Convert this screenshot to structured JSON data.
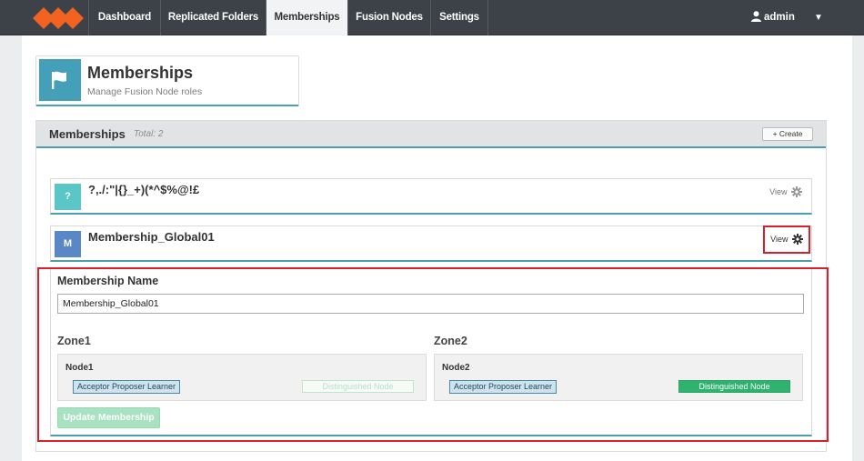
{
  "nav": {
    "items": [
      {
        "label": "Dashboard",
        "active": false
      },
      {
        "label": "Replicated Folders",
        "active": false
      },
      {
        "label": "Memberships",
        "active": true
      },
      {
        "label": "Fusion Nodes",
        "active": false
      },
      {
        "label": "Settings",
        "active": false
      }
    ],
    "user": "admin",
    "user_icon": "user-icon",
    "menu_icon": "caret-down-icon"
  },
  "header": {
    "title": "Memberships",
    "subtitle": "Manage Fusion Node roles",
    "icon": "flag-icon"
  },
  "panel": {
    "title": "Memberships",
    "total": "Total: 2",
    "create_label": "+ Create"
  },
  "memberships": [
    {
      "badge": "?",
      "badge_color": "#5bc6c8",
      "name": "?,./:\"|{}_+)(*^$%@!£",
      "view_label": "View"
    },
    {
      "badge": "M",
      "badge_color": "#5a87c5",
      "name": "Membership_Global01",
      "view_label": "View"
    }
  ],
  "detail": {
    "name_label": "Membership Name",
    "name_value": "Membership_Global01",
    "zones": [
      {
        "label": "Zone1",
        "node": "Node1",
        "roles": "Acceptor Proposer Learner",
        "distinguished": false,
        "dist_label": "Distinguished Node"
      },
      {
        "label": "Zone2",
        "node": "Node2",
        "roles": "Acceptor Proposer Learner",
        "distinguished": true,
        "dist_label": "Distinguished Node"
      }
    ],
    "update_label": "Update Membership"
  },
  "colors": {
    "accent": "#4a9fb1",
    "nav_bg": "#3c4248",
    "highlight": "#d6202b",
    "success": "#2eb26e",
    "logo": "#f26322"
  }
}
